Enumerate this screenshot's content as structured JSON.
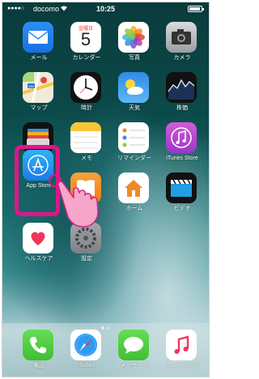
{
  "status_bar": {
    "carrier": "docomo",
    "time": "10:25"
  },
  "calendar": {
    "weekday": "金曜日",
    "day": "5"
  },
  "apps": [
    {
      "label": "メール",
      "icon": "mail-icon"
    },
    {
      "label": "カレンダー",
      "icon": "calendar-icon"
    },
    {
      "label": "写真",
      "icon": "photos-icon"
    },
    {
      "label": "カメラ",
      "icon": "camera-icon"
    },
    {
      "label": "マップ",
      "icon": "maps-icon"
    },
    {
      "label": "時計",
      "icon": "clock-icon"
    },
    {
      "label": "天気",
      "icon": "weather-icon"
    },
    {
      "label": "株価",
      "icon": "stocks-icon"
    },
    {
      "label": "Wallet",
      "icon": "wallet-icon"
    },
    {
      "label": "メモ",
      "icon": "notes-icon"
    },
    {
      "label": "リマインダー",
      "icon": "reminders-icon"
    },
    {
      "label": "iTunes Store",
      "icon": "itunes-store-icon"
    },
    {
      "label": "App Store",
      "icon": "app-store-icon"
    },
    {
      "label": "iBooks",
      "icon": "ibooks-icon"
    },
    {
      "label": "ホーム",
      "icon": "home-icon"
    },
    {
      "label": "ビデオ",
      "icon": "videos-icon"
    },
    {
      "label": "ヘルスケア",
      "icon": "health-icon"
    },
    {
      "label": "設定",
      "icon": "settings-icon"
    }
  ],
  "dock": [
    {
      "label": "電話",
      "icon": "phone-icon"
    },
    {
      "label": "Safari",
      "icon": "safari-icon"
    },
    {
      "label": "メッセージ",
      "icon": "messages-icon"
    },
    {
      "label": "ミュージック",
      "icon": "music-icon"
    }
  ],
  "page_indicator": {
    "pages": 2,
    "current": 1
  },
  "annotation": {
    "highlight_color": "#e0158a",
    "target": "App Store"
  }
}
